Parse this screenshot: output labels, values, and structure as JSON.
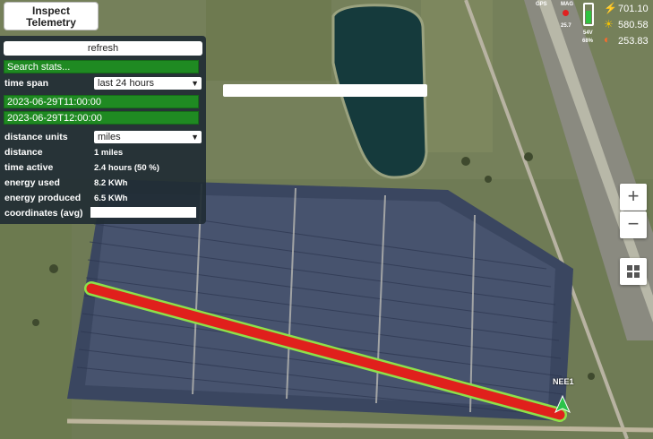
{
  "inspect_button": {
    "label": "Inspect\nTelemetry"
  },
  "panel": {
    "refresh_label": "refresh",
    "search_placeholder": "Search stats...",
    "time_span": {
      "label": "time span",
      "value": "last 24 hours"
    },
    "start_time": "2023-06-29T11:00:00",
    "end_time": "2023-06-29T12:00:00",
    "distance_units": {
      "label": "distance units",
      "value": "miles"
    },
    "stats": [
      {
        "label": "distance",
        "value": "1 miles"
      },
      {
        "label": "time active",
        "value": "2.4 hours (50 %)"
      },
      {
        "label": "energy used",
        "value": "8.2 KWh"
      },
      {
        "label": "energy produced",
        "value": "6.5 KWh"
      }
    ],
    "coordinates_label": "coordinates (avg)",
    "coordinates_value": ""
  },
  "status": {
    "gps_label": "GPS",
    "mag_label": "MAG",
    "mag_value": "25.7",
    "battery_voltage": "54V",
    "battery_percent": "68%",
    "battery_level": 0.68,
    "power_value": "701.10",
    "solar_value": "580.58",
    "consumption_value": "253.83"
  },
  "map": {
    "marker_label": "NEE1",
    "zoom_in_label": "+",
    "zoom_out_label": "−",
    "layers_icon": "layers-icon",
    "track_color": "#e0201c",
    "track_outline_color": "#8ee04a"
  }
}
